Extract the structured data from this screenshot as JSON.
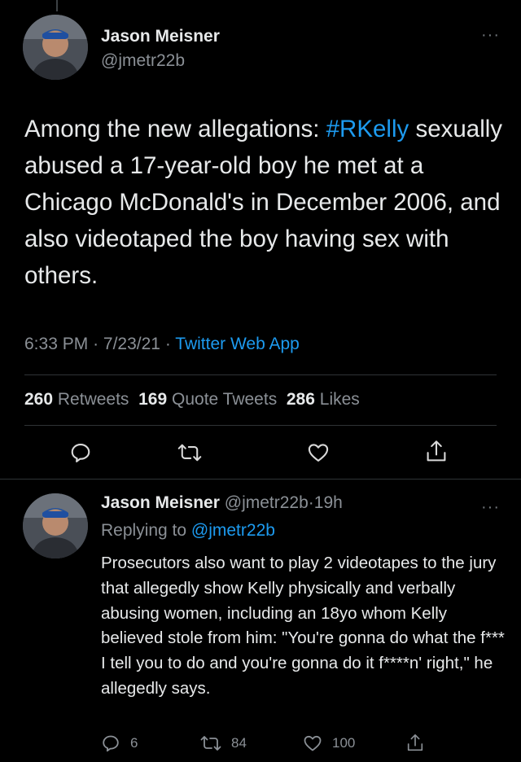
{
  "main_tweet": {
    "author_name": "Jason Meisner",
    "author_handle": "@jmetr22b",
    "more_label": "···",
    "text_before": "Among the new allegations: ",
    "hashtag": "#RKelly",
    "text_after": " sexually abused a 17-year-old boy he met at a Chicago McDonald's in December 2006, and also videotaped the boy having sex with others.",
    "time": "6:33 PM",
    "date": "7/23/21",
    "dot": "·",
    "app": "Twitter Web App",
    "retweets_count": "260",
    "retweets_label": "Retweets",
    "quotes_count": "169",
    "quotes_label": "Quote Tweets",
    "likes_count": "286",
    "likes_label": "Likes"
  },
  "reply_tweet": {
    "author_name": "Jason Meisner",
    "author_handle": "@jmetr22b",
    "age": "19h",
    "more_label": "···",
    "replying_prefix": "Replying to",
    "replying_to": "@jmetr22b",
    "text": "Prosecutors also want to play 2 videotapes to the jury that allegedly show Kelly physically and verbally abusing women, including an 18yo whom Kelly believed stole from him: \"You're gonna do what the f*** I tell you to do and you're gonna do it f****n' right,\" he allegedly says.",
    "reply_count": "6",
    "retweet_count": "84",
    "like_count": "100"
  },
  "icons": [
    "reply-icon",
    "retweet-icon",
    "like-icon",
    "share-icon",
    "more-icon",
    "avatar"
  ]
}
